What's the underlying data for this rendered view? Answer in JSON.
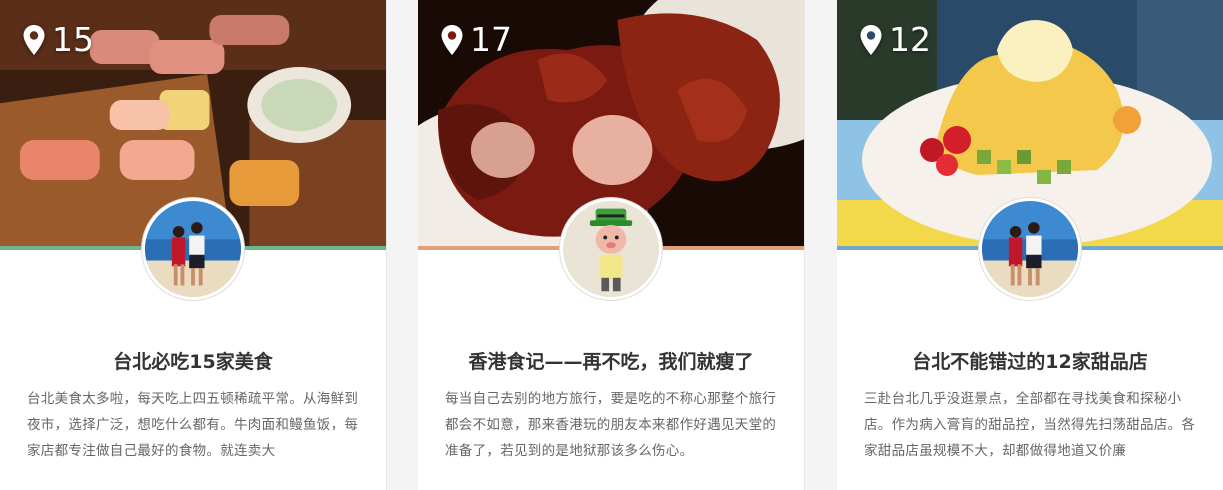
{
  "colors": {
    "accent_green": "#6fb58c",
    "accent_orange": "#e2a07a",
    "accent_blue": "#6fa8c8",
    "title": "#333333",
    "desc": "#666666"
  },
  "cards": [
    {
      "location_icon": "map-pin-icon",
      "count": "15",
      "title": "台北必吃15家美食",
      "desc": "台北美食太多啦，每天吃上四五顿稀疏平常。从海鲜到夜市，选择广泛，想吃什么都有。牛肉面和鳗鱼饭，每家店都专注做自己最好的食物。就连卖大",
      "cover": "sushi-platter-photo",
      "avatar": "couple-beach-avatar"
    },
    {
      "location_icon": "map-pin-icon",
      "count": "17",
      "title": "香港食记——再不吃，我们就瘦了",
      "desc": "每当自己去别的地方旅行，要是吃的不称心那整个旅行都会不如意，那来香港玩的朋友本来都作好遇见天堂的准备了，若见到的是地狱那该多么伤心。",
      "cover": "char-siu-photo",
      "avatar": "toy-figure-avatar"
    },
    {
      "location_icon": "map-pin-icon",
      "count": "12",
      "title": "台北不能错过的12家甜品店",
      "desc": "三赴台北几乎没逛景点，全部都在寻找美食和探秘小店。作为病入膏肓的甜品控，当然得先扫荡甜品店。各家甜品店虽规模不大，却都做得地道又价廉",
      "cover": "mango-shaved-ice-photo",
      "avatar": "couple-beach-avatar"
    }
  ]
}
